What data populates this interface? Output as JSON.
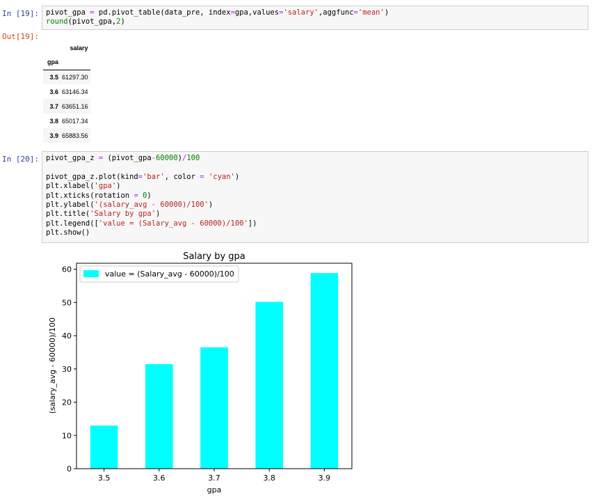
{
  "cells": {
    "cell19": {
      "in_prompt": "In [19]:",
      "out_prompt": "Out[19]:",
      "code": [
        "pivot_gpa = pd.pivot_table(data_pre, index=gpa,values='salary',aggfunc='mean')",
        "round(pivot_gpa,2)"
      ]
    },
    "cell20": {
      "in_prompt": "In [20]:",
      "code": [
        "pivot_gpa_z = (pivot_gpa-60000)/100",
        "",
        "pivot_gpa_z.plot(kind='bar', color = 'cyan')",
        "plt.xlabel('gpa')",
        "plt.xticks(rotation = 0)",
        "plt.ylabel('(salary_avg - 60000)/100')",
        "plt.title('Salary by gpa')",
        "plt.legend(['value = (Salary_avg - 60000)/100'])",
        "plt.show()"
      ]
    }
  },
  "dataframe": {
    "column_header": "salary",
    "index_name": "gpa",
    "rows": [
      {
        "index": "3.5",
        "value": "61297.30"
      },
      {
        "index": "3.6",
        "value": "63146.34"
      },
      {
        "index": "3.7",
        "value": "63651.16"
      },
      {
        "index": "3.8",
        "value": "65017.34"
      },
      {
        "index": "3.9",
        "value": "65883.56"
      }
    ]
  },
  "colors": {
    "bar": "#00ffff",
    "code_bg": "#f7f7f7",
    "in_prompt": "#303f9f",
    "out_prompt": "#d84315"
  },
  "chart_data": {
    "type": "bar",
    "title": "Salary by gpa",
    "xlabel": "gpa",
    "ylabel": "(salary_avg - 60000)/100",
    "categories": [
      "3.5",
      "3.6",
      "3.7",
      "3.8",
      "3.9"
    ],
    "series": [
      {
        "name": "value = (Salary_avg - 60000)/100",
        "values": [
          12.97,
          31.46,
          36.51,
          50.17,
          58.84
        ],
        "color": "#00ffff"
      }
    ],
    "ylim": [
      0,
      61.8
    ],
    "yticks": [
      "0",
      "10",
      "20",
      "30",
      "40",
      "50",
      "60"
    ],
    "legend": "upper-left",
    "grid": false
  }
}
